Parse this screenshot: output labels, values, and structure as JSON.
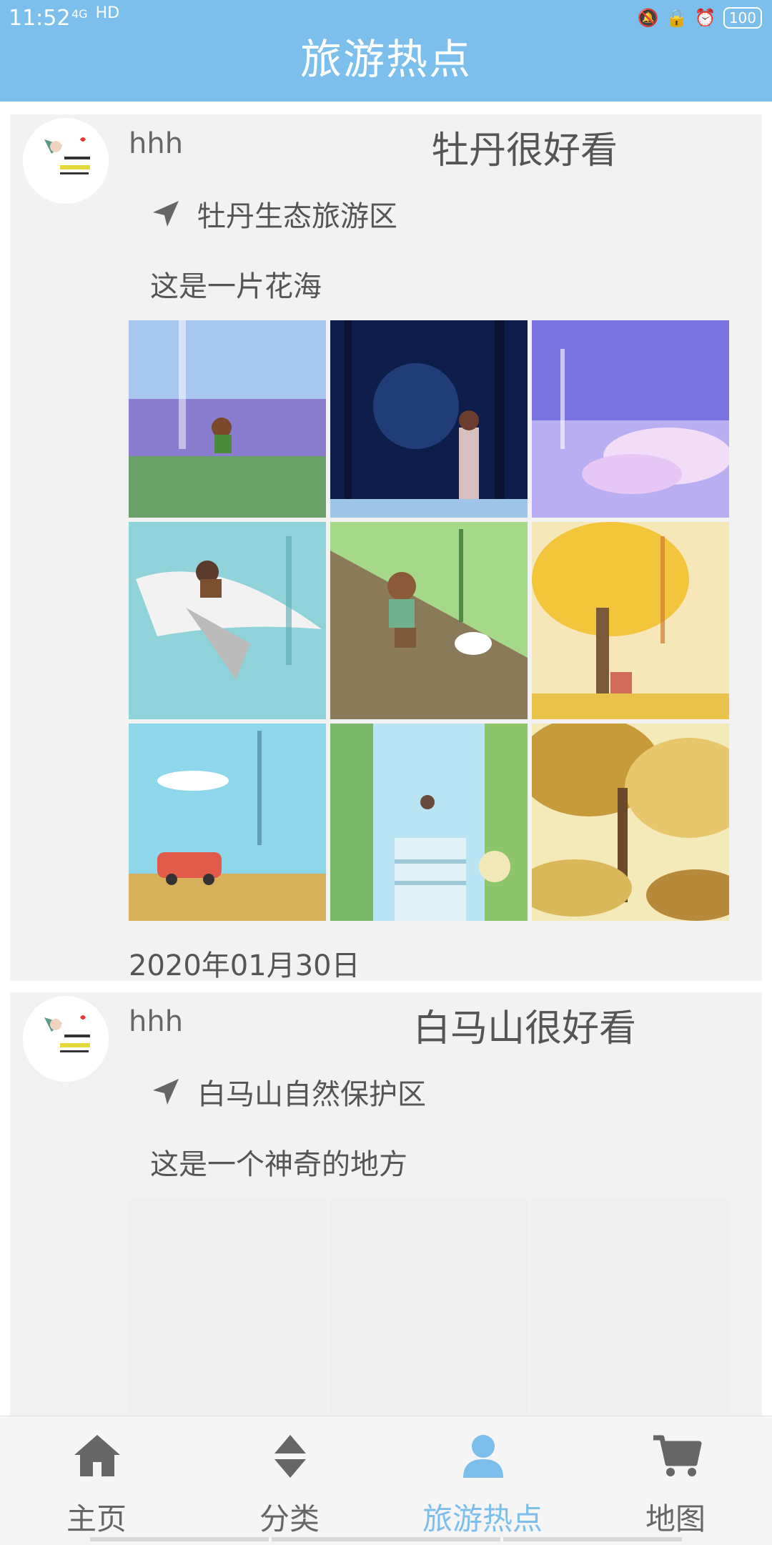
{
  "status_bar": {
    "time": "11:52",
    "network": "4G",
    "hd": "HD",
    "battery": "100"
  },
  "header": {
    "title": "旅游热点"
  },
  "posts": [
    {
      "username": "hhh",
      "title": "牡丹很好看",
      "location": "牡丹生态旅游区",
      "description": "这是一片花海",
      "date": "2020年01月30日",
      "images": [
        {
          "colors": [
            "#8fb7e6",
            "#b9d4ef",
            "#7e6bc9"
          ]
        },
        {
          "colors": [
            "#0e1e4a",
            "#2a4a8c",
            "#6f8cc9"
          ]
        },
        {
          "colors": [
            "#6d6fe0",
            "#b2a9f0",
            "#f2d7f5"
          ]
        },
        {
          "colors": [
            "#7bc6d0",
            "#b9e3e7",
            "#e7f5f6"
          ]
        },
        {
          "colors": [
            "#8cc572",
            "#7b6a4d",
            "#dce8a0"
          ]
        },
        {
          "colors": [
            "#f2c53a",
            "#f7e28a",
            "#f9eec0"
          ]
        },
        {
          "colors": [
            "#7fd3e6",
            "#c9eef5",
            "#e8c27e"
          ]
        },
        {
          "colors": [
            "#9ad7f0",
            "#a6d37a",
            "#e6f4c9"
          ]
        },
        {
          "colors": [
            "#c7a24a",
            "#e6c76b",
            "#8a6a2a"
          ]
        }
      ]
    },
    {
      "username": "hhh",
      "title": "白马山很好看",
      "location": "白马山自然保护区",
      "description": "这是一个神奇的地方"
    }
  ],
  "nav": {
    "items": [
      {
        "label": "主页",
        "icon": "home-icon"
      },
      {
        "label": "分类",
        "icon": "sort-icon"
      },
      {
        "label": "旅游热点",
        "icon": "person-icon"
      },
      {
        "label": "地图",
        "icon": "cart-icon"
      }
    ],
    "active": 2,
    "active_color": "#7dbfec",
    "inactive_color": "#666666"
  }
}
